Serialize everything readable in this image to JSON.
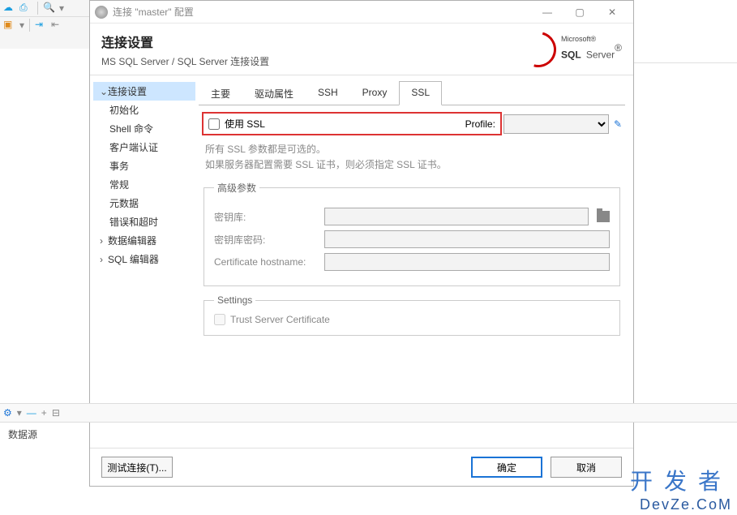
{
  "dialog": {
    "title": "连接 \"master\" 配置",
    "heading": "连接设置",
    "subtitle": "MS SQL Server / SQL Server 连接设置"
  },
  "logo": {
    "microsoft": "Microsoft®",
    "sql": "SQL",
    "server": "Server",
    "reg": "®"
  },
  "sidebar": {
    "items": [
      {
        "label": "连接设置",
        "top": true,
        "expanded": true,
        "selected": true
      },
      {
        "label": "初始化"
      },
      {
        "label": "Shell 命令"
      },
      {
        "label": "客户端认证"
      },
      {
        "label": "事务"
      },
      {
        "label": "常规",
        "top": true
      },
      {
        "label": "元数据",
        "top": true
      },
      {
        "label": "错误和超时",
        "top": true
      },
      {
        "label": "数据编辑器",
        "top": true,
        "expander": "›"
      },
      {
        "label": "SQL 编辑器",
        "top": true,
        "expander": "›"
      }
    ]
  },
  "tabs": [
    {
      "label": "主要"
    },
    {
      "label": "驱动属性"
    },
    {
      "label": "SSH"
    },
    {
      "label": "Proxy"
    },
    {
      "label": "SSL",
      "active": true
    }
  ],
  "ssl": {
    "use_ssl": "使用 SSL",
    "profile_label": "Profile:",
    "hint1": "所有 SSL 参数都是可选的。",
    "hint2": "如果服务器配置需要 SSL 证书，则必须指定 SSL 证书。"
  },
  "advanced": {
    "legend": "高级参数",
    "keystore": "密钥库:",
    "keystore_password": "密钥库密码:",
    "cert_hostname": "Certificate hostname:"
  },
  "settings": {
    "legend": "Settings",
    "trust": "Trust Server Certificate"
  },
  "buttons": {
    "test": "测试连接(T)...",
    "ok": "确定",
    "cancel": "取消"
  },
  "bottom": {
    "tab": "数据源"
  },
  "watermark": {
    "cn": "开发者",
    "en": "DevZe.CoM"
  }
}
